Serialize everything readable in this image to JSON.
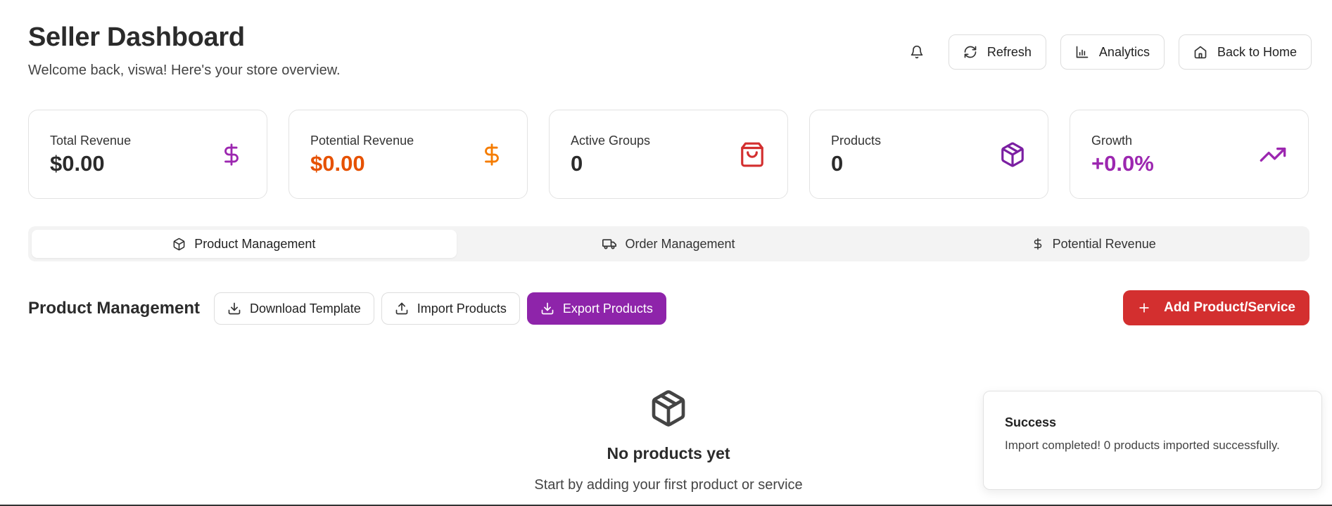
{
  "header": {
    "title": "Seller Dashboard",
    "subtitle": "Welcome back, viswa! Here's your store overview.",
    "buttons": {
      "refresh": "Refresh",
      "analytics": "Analytics",
      "home": "Back to Home"
    }
  },
  "stats": [
    {
      "label": "Total Revenue",
      "value": "$0.00",
      "icon": "dollar-icon",
      "color": "#9c27b0",
      "value_color": "#2b2b2b"
    },
    {
      "label": "Potential Revenue",
      "value": "$0.00",
      "icon": "dollar-icon",
      "color": "#f57c00",
      "value_color": "#e65100"
    },
    {
      "label": "Active Groups",
      "value": "0",
      "icon": "shopping-bag-icon",
      "color": "#d32f2f",
      "value_color": "#2b2b2b"
    },
    {
      "label": "Products",
      "value": "0",
      "icon": "package-icon",
      "color": "#7b1fa2",
      "value_color": "#2b2b2b"
    },
    {
      "label": "Growth",
      "value": "+0.0%",
      "icon": "trending-up-icon",
      "color": "#9c27b0",
      "value_color": "#9c27b0"
    }
  ],
  "tabs": [
    {
      "label": "Product Management",
      "icon": "package-icon",
      "active": true
    },
    {
      "label": "Order Management",
      "icon": "truck-icon",
      "active": false
    },
    {
      "label": "Potential Revenue",
      "icon": "dollar-icon",
      "active": false
    }
  ],
  "product_management": {
    "title": "Product Management",
    "download_template": "Download Template",
    "import_products": "Import Products",
    "export_products": "Export Products",
    "add_product": "Add Product/Service"
  },
  "empty_state": {
    "title": "No products yet",
    "subtitle": "Start by adding your first product or service"
  },
  "toast": {
    "title": "Success",
    "message": "Import completed! 0 products imported successfully."
  },
  "colors": {
    "accent_purple": "#8e24aa",
    "accent_red": "#d32f2f",
    "accent_orange": "#f57c00"
  }
}
